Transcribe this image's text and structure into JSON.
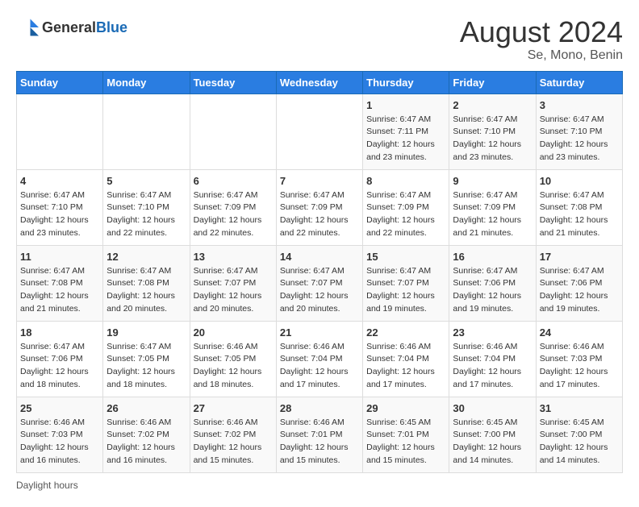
{
  "logo": {
    "text_general": "General",
    "text_blue": "Blue"
  },
  "header": {
    "month_year": "August 2024",
    "location": "Se, Mono, Benin"
  },
  "days_of_week": [
    "Sunday",
    "Monday",
    "Tuesday",
    "Wednesday",
    "Thursday",
    "Friday",
    "Saturday"
  ],
  "weeks": [
    [
      {
        "day": "",
        "info": ""
      },
      {
        "day": "",
        "info": ""
      },
      {
        "day": "",
        "info": ""
      },
      {
        "day": "",
        "info": ""
      },
      {
        "day": "1",
        "info": "Sunrise: 6:47 AM\nSunset: 7:11 PM\nDaylight: 12 hours\nand 23 minutes."
      },
      {
        "day": "2",
        "info": "Sunrise: 6:47 AM\nSunset: 7:10 PM\nDaylight: 12 hours\nand 23 minutes."
      },
      {
        "day": "3",
        "info": "Sunrise: 6:47 AM\nSunset: 7:10 PM\nDaylight: 12 hours\nand 23 minutes."
      }
    ],
    [
      {
        "day": "4",
        "info": "Sunrise: 6:47 AM\nSunset: 7:10 PM\nDaylight: 12 hours\nand 23 minutes."
      },
      {
        "day": "5",
        "info": "Sunrise: 6:47 AM\nSunset: 7:10 PM\nDaylight: 12 hours\nand 22 minutes."
      },
      {
        "day": "6",
        "info": "Sunrise: 6:47 AM\nSunset: 7:09 PM\nDaylight: 12 hours\nand 22 minutes."
      },
      {
        "day": "7",
        "info": "Sunrise: 6:47 AM\nSunset: 7:09 PM\nDaylight: 12 hours\nand 22 minutes."
      },
      {
        "day": "8",
        "info": "Sunrise: 6:47 AM\nSunset: 7:09 PM\nDaylight: 12 hours\nand 22 minutes."
      },
      {
        "day": "9",
        "info": "Sunrise: 6:47 AM\nSunset: 7:09 PM\nDaylight: 12 hours\nand 21 minutes."
      },
      {
        "day": "10",
        "info": "Sunrise: 6:47 AM\nSunset: 7:08 PM\nDaylight: 12 hours\nand 21 minutes."
      }
    ],
    [
      {
        "day": "11",
        "info": "Sunrise: 6:47 AM\nSunset: 7:08 PM\nDaylight: 12 hours\nand 21 minutes."
      },
      {
        "day": "12",
        "info": "Sunrise: 6:47 AM\nSunset: 7:08 PM\nDaylight: 12 hours\nand 20 minutes."
      },
      {
        "day": "13",
        "info": "Sunrise: 6:47 AM\nSunset: 7:07 PM\nDaylight: 12 hours\nand 20 minutes."
      },
      {
        "day": "14",
        "info": "Sunrise: 6:47 AM\nSunset: 7:07 PM\nDaylight: 12 hours\nand 20 minutes."
      },
      {
        "day": "15",
        "info": "Sunrise: 6:47 AM\nSunset: 7:07 PM\nDaylight: 12 hours\nand 19 minutes."
      },
      {
        "day": "16",
        "info": "Sunrise: 6:47 AM\nSunset: 7:06 PM\nDaylight: 12 hours\nand 19 minutes."
      },
      {
        "day": "17",
        "info": "Sunrise: 6:47 AM\nSunset: 7:06 PM\nDaylight: 12 hours\nand 19 minutes."
      }
    ],
    [
      {
        "day": "18",
        "info": "Sunrise: 6:47 AM\nSunset: 7:06 PM\nDaylight: 12 hours\nand 18 minutes."
      },
      {
        "day": "19",
        "info": "Sunrise: 6:47 AM\nSunset: 7:05 PM\nDaylight: 12 hours\nand 18 minutes."
      },
      {
        "day": "20",
        "info": "Sunrise: 6:46 AM\nSunset: 7:05 PM\nDaylight: 12 hours\nand 18 minutes."
      },
      {
        "day": "21",
        "info": "Sunrise: 6:46 AM\nSunset: 7:04 PM\nDaylight: 12 hours\nand 17 minutes."
      },
      {
        "day": "22",
        "info": "Sunrise: 6:46 AM\nSunset: 7:04 PM\nDaylight: 12 hours\nand 17 minutes."
      },
      {
        "day": "23",
        "info": "Sunrise: 6:46 AM\nSunset: 7:04 PM\nDaylight: 12 hours\nand 17 minutes."
      },
      {
        "day": "24",
        "info": "Sunrise: 6:46 AM\nSunset: 7:03 PM\nDaylight: 12 hours\nand 17 minutes."
      }
    ],
    [
      {
        "day": "25",
        "info": "Sunrise: 6:46 AM\nSunset: 7:03 PM\nDaylight: 12 hours\nand 16 minutes."
      },
      {
        "day": "26",
        "info": "Sunrise: 6:46 AM\nSunset: 7:02 PM\nDaylight: 12 hours\nand 16 minutes."
      },
      {
        "day": "27",
        "info": "Sunrise: 6:46 AM\nSunset: 7:02 PM\nDaylight: 12 hours\nand 15 minutes."
      },
      {
        "day": "28",
        "info": "Sunrise: 6:46 AM\nSunset: 7:01 PM\nDaylight: 12 hours\nand 15 minutes."
      },
      {
        "day": "29",
        "info": "Sunrise: 6:45 AM\nSunset: 7:01 PM\nDaylight: 12 hours\nand 15 minutes."
      },
      {
        "day": "30",
        "info": "Sunrise: 6:45 AM\nSunset: 7:00 PM\nDaylight: 12 hours\nand 14 minutes."
      },
      {
        "day": "31",
        "info": "Sunrise: 6:45 AM\nSunset: 7:00 PM\nDaylight: 12 hours\nand 14 minutes."
      }
    ]
  ],
  "footer": {
    "daylight_label": "Daylight hours"
  }
}
